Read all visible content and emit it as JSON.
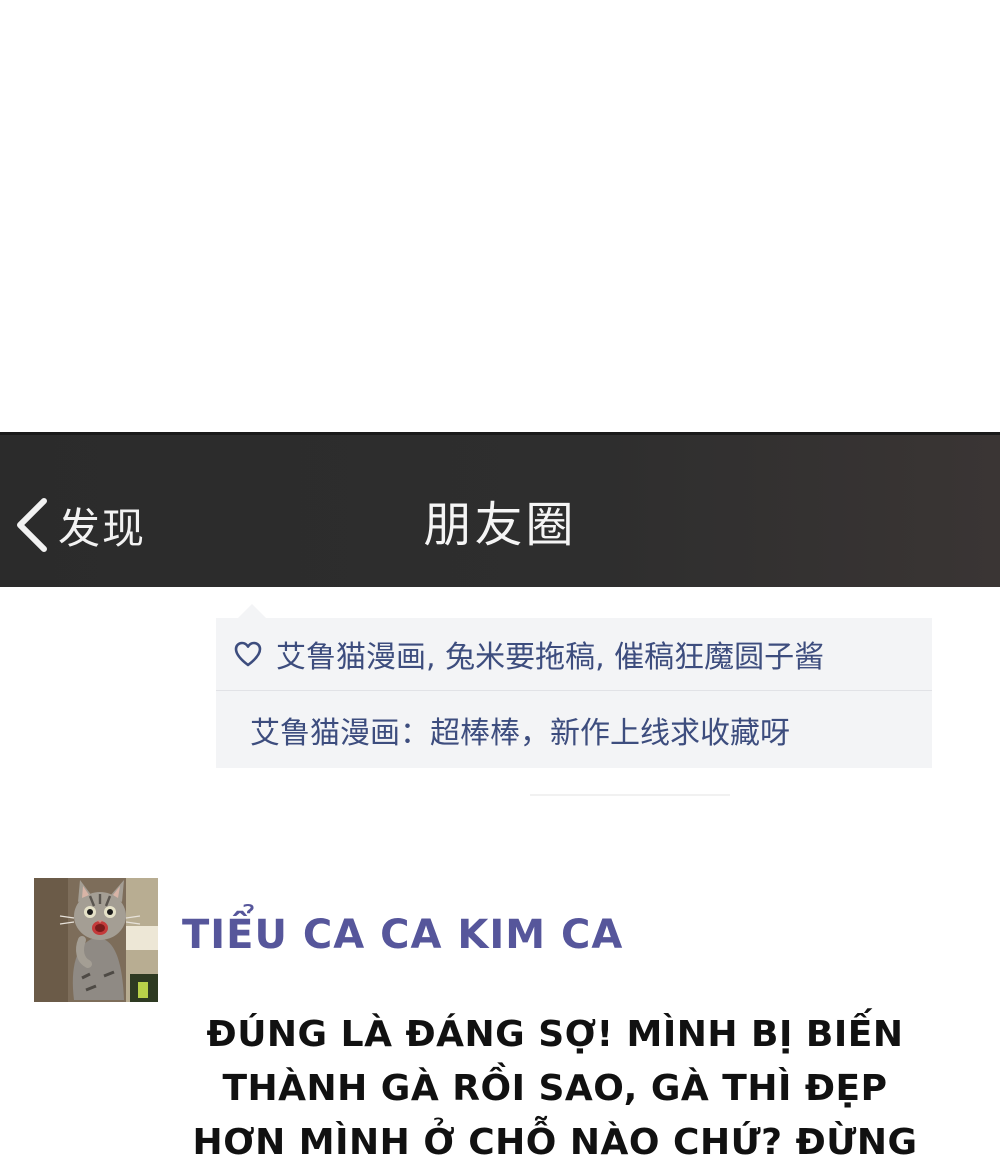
{
  "nav": {
    "back_label": "发现",
    "title": "朋友圈"
  },
  "likes": {
    "icon": "heart-outline-icon",
    "text": "艾鲁猫漫画, 兔米要拖稿, 催稿狂魔圆子酱"
  },
  "comment": {
    "text": "艾鲁猫漫画：超棒棒，新作上线求收藏呀"
  },
  "post": {
    "avatar": "surprised-cat-avatar",
    "username": "TIỂU CA CA KIM CA",
    "caption_lines": [
      "ĐÚNG LÀ ĐÁNG SỢ! MÌNH BỊ BIẾN",
      "THÀNH GÀ RỒI SAO, GÀ THÌ ĐẸP",
      "HƠN MÌNH Ở CHỖ NÀO CHỨ? ĐỪNG"
    ]
  },
  "colors": {
    "navbar": "#2e2e2e",
    "link_blue": "#3d4d7e",
    "username": "#56569b"
  }
}
